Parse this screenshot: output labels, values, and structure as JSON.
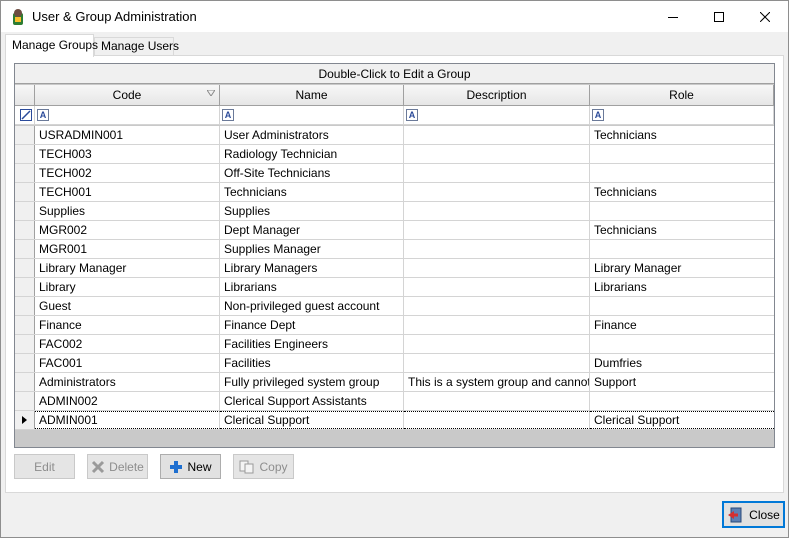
{
  "window": {
    "title": "User & Group Administration"
  },
  "tabs": [
    {
      "label": "Manage Groups",
      "active": true
    },
    {
      "label": "Manage Users",
      "active": false
    }
  ],
  "grid": {
    "caption": "Double-Click to Edit a Group",
    "columns": [
      "Code",
      "Name",
      "Description",
      "Role"
    ],
    "rows": [
      {
        "code": "USRADMIN001",
        "name": "User Administrators",
        "description": "",
        "role": "Technicians"
      },
      {
        "code": "TECH003",
        "name": "Radiology Technician",
        "description": "",
        "role": ""
      },
      {
        "code": "TECH002",
        "name": "Off-Site Technicians",
        "description": "",
        "role": ""
      },
      {
        "code": "TECH001",
        "name": "Technicians",
        "description": "",
        "role": "Technicians"
      },
      {
        "code": "Supplies",
        "name": "Supplies",
        "description": "",
        "role": ""
      },
      {
        "code": "MGR002",
        "name": "Dept Manager",
        "description": "",
        "role": "Technicians"
      },
      {
        "code": "MGR001",
        "name": "Supplies Manager",
        "description": "",
        "role": ""
      },
      {
        "code": "Library Manager",
        "name": "Library Managers",
        "description": "",
        "role": "Library Manager"
      },
      {
        "code": "Library",
        "name": "Librarians",
        "description": "",
        "role": "Librarians"
      },
      {
        "code": "Guest",
        "name": "Non-privileged guest account",
        "description": "",
        "role": ""
      },
      {
        "code": "Finance",
        "name": "Finance Dept",
        "description": "",
        "role": "Finance"
      },
      {
        "code": "FAC002",
        "name": "Facilities Engineers",
        "description": "",
        "role": ""
      },
      {
        "code": "FAC001",
        "name": "Facilities",
        "description": "",
        "role": "Dumfries"
      },
      {
        "code": "Administrators",
        "name": "Fully privileged system group",
        "description": "This is a system group and cannot",
        "role": "Support"
      },
      {
        "code": "ADMIN002",
        "name": "Clerical Support Assistants",
        "description": "",
        "role": ""
      },
      {
        "code": "ADMIN001",
        "name": "Clerical Support",
        "description": "",
        "role": "Clerical Support",
        "current": true
      }
    ]
  },
  "buttons": {
    "edit": "Edit",
    "delete": "Delete",
    "new": "New",
    "copy": "Copy",
    "close": "Close"
  },
  "colors": {
    "accent": "#0078d7",
    "new_icon": "#1e6fd0",
    "delete_icon": "#9a9a9a"
  }
}
